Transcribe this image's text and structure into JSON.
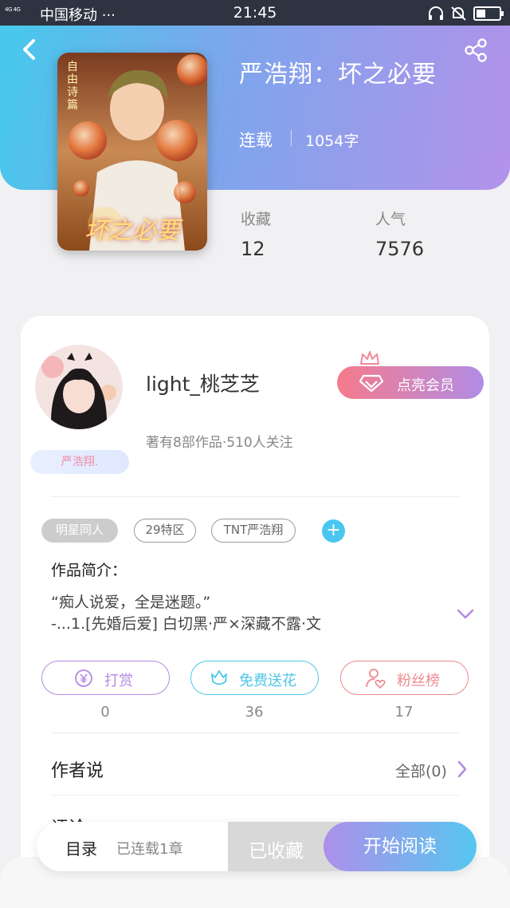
{
  "status_bar": {
    "signal": "4G 4G",
    "carrier": "中国移动 ···",
    "time": "21:45"
  },
  "header": {
    "back_icon": "chevron-left-icon",
    "share_icon": "share-icon"
  },
  "book": {
    "title": "严浩翔：坏之必要",
    "status": "连载",
    "word_count": "1054字",
    "cover_text": "坏之必要",
    "cover_side_text": "自由诗篇",
    "stats": [
      {
        "label": "收藏",
        "value": "12"
      },
      {
        "label": "人气",
        "value": "7576"
      }
    ]
  },
  "author": {
    "name": "light_桃芝芝",
    "meta": "著有8部作品·510人关注",
    "fan_badge": "严浩翔.",
    "vip_button": "点亮会员"
  },
  "tags": [
    "明星同人",
    "29特区",
    "TNT严浩翔"
  ],
  "intro": {
    "label": "作品简介：",
    "text": "“痴人说爱，全是迷题。”\n-...1.[先婚后爱] 白切黑·严×深藏不露·文"
  },
  "actions": [
    {
      "label": "打赏",
      "icon": "yen-coin-icon",
      "count": "0",
      "color": "#b48ae3"
    },
    {
      "label": "免费送花",
      "icon": "flower-icon",
      "count": "36",
      "color": "#4ec6e8"
    },
    {
      "label": "粉丝榜",
      "icon": "user-heart-icon",
      "count": "17",
      "color": "#ef8a8e"
    }
  ],
  "author_says": {
    "title": "作者说",
    "view_all": "全部(0)"
  },
  "comments_peek": "评论",
  "bottom_bar": {
    "toc": "目录",
    "serial": "已连载1章",
    "fav": "已收藏",
    "read": "开始阅读"
  },
  "colors": {
    "accent_blue": "#46c9ec",
    "accent_purple": "#b392ea"
  }
}
